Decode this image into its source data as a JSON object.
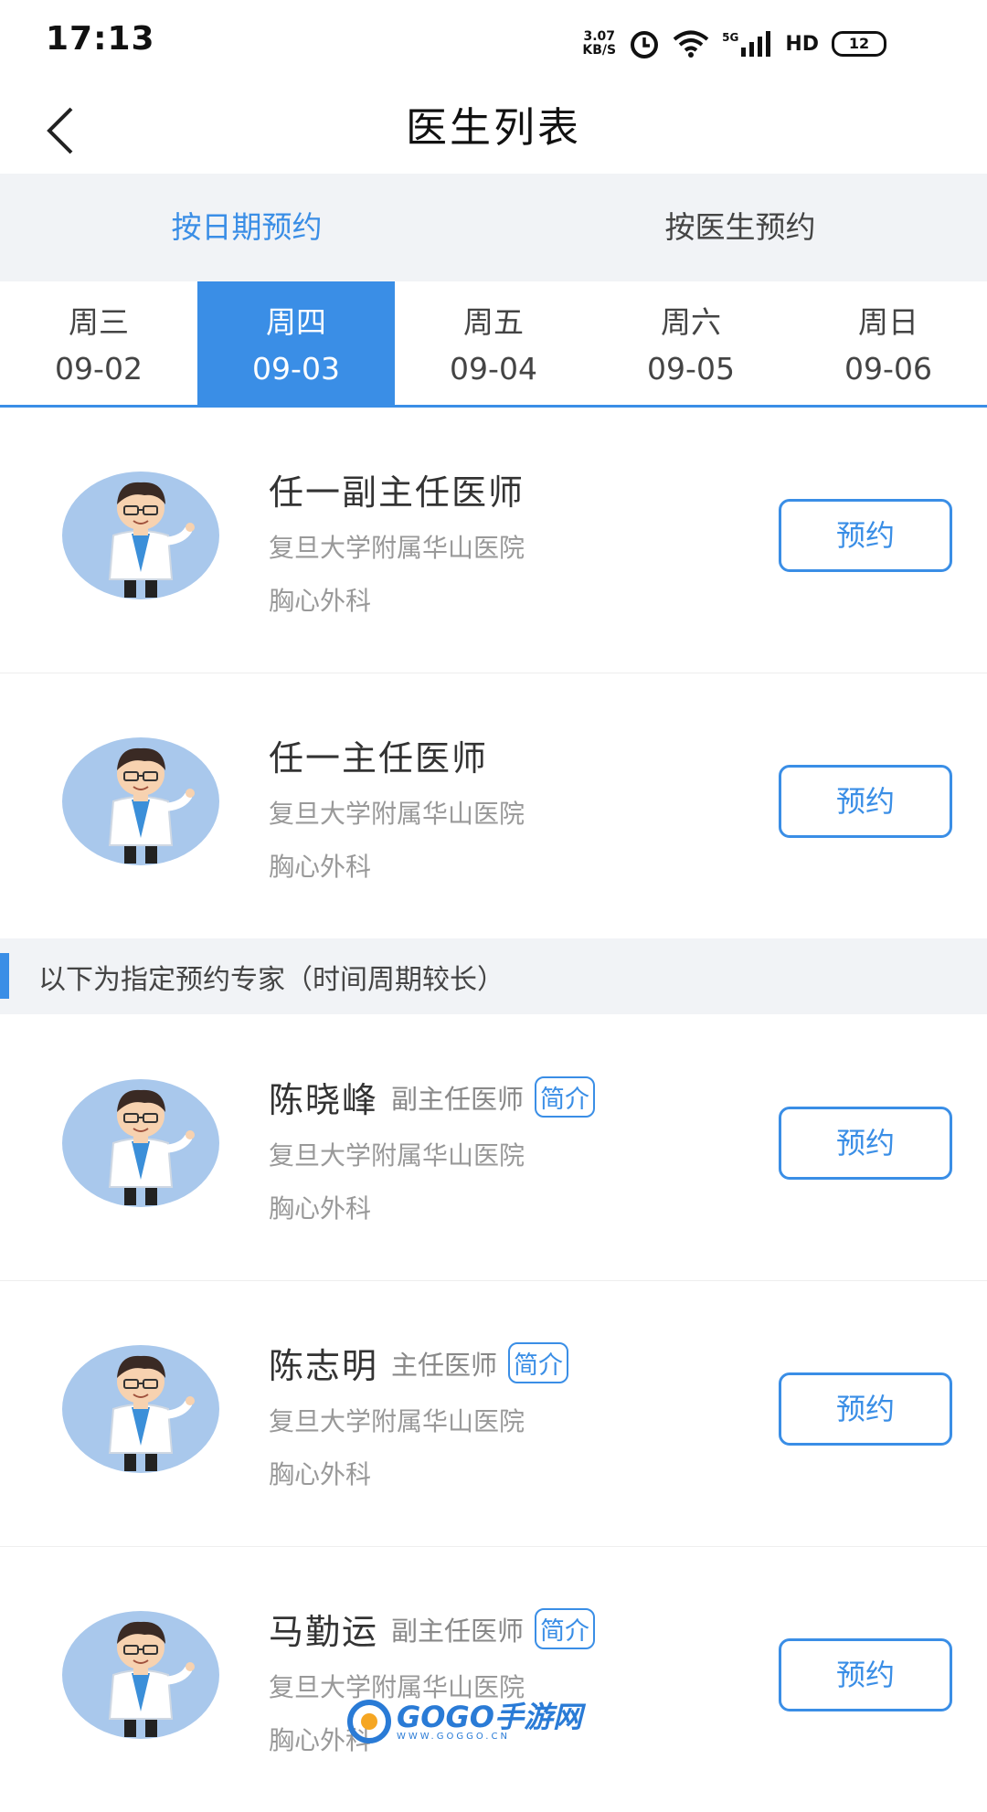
{
  "status_bar": {
    "time": "17:13",
    "net_speed_value": "3.07",
    "net_speed_unit": "KB/S",
    "signal_label": "5G",
    "hd_label": "HD",
    "battery": "12",
    "icons": [
      "alarm-icon",
      "wifi-icon",
      "signal-icon",
      "hd-icon",
      "battery-icon"
    ]
  },
  "header": {
    "title": "医生列表",
    "back_icon": "chevron-left-icon"
  },
  "mode_tabs": [
    {
      "label": "按日期预约",
      "active": true
    },
    {
      "label": "按医生预约",
      "active": false
    }
  ],
  "date_tabs": [
    {
      "weekday": "周三",
      "date": "09-02",
      "active": false
    },
    {
      "weekday": "周四",
      "date": "09-03",
      "active": true
    },
    {
      "weekday": "周五",
      "date": "09-04",
      "active": false
    },
    {
      "weekday": "周六",
      "date": "09-05",
      "active": false
    },
    {
      "weekday": "周日",
      "date": "09-06",
      "active": false
    }
  ],
  "doctors": [
    {
      "name": "任一副主任医师",
      "hospital": "复旦大学附属华山医院",
      "department": "胸心外科",
      "button": "预约"
    },
    {
      "name": "任一主任医师",
      "hospital": "复旦大学附属华山医院",
      "department": "胸心外科",
      "button": "预约"
    }
  ],
  "section": {
    "label": "以下为指定预约专家（时间周期较长）"
  },
  "experts": [
    {
      "name": "陈晓峰",
      "title": "副主任医师",
      "intro": "简介",
      "hospital": "复旦大学附属华山医院",
      "department": "胸心外科",
      "button": "预约"
    },
    {
      "name": "陈志明",
      "title": "主任医师",
      "intro": "简介",
      "hospital": "复旦大学附属华山医院",
      "department": "胸心外科",
      "button": "预约"
    },
    {
      "name": "马勤运",
      "title": "副主任医师",
      "intro": "简介",
      "hospital": "复旦大学附属华山医院",
      "department": "胸心外科",
      "button": "预约"
    }
  ],
  "watermark": {
    "text": "GOGO手游网",
    "sub": "WWW.GOGGO.CN"
  },
  "colors": {
    "accent": "#3a8ee6",
    "tab_bg": "#f1f3f6",
    "avatar_bg": "#a9c8ec"
  }
}
